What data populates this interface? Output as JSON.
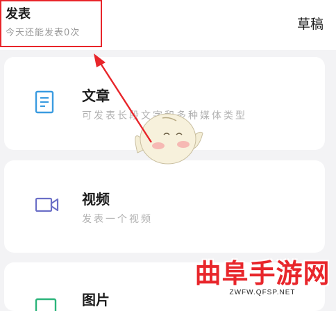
{
  "header": {
    "title": "发表",
    "subtitle": "今天还能发表0次",
    "draft_label": "草稿"
  },
  "options": [
    {
      "title": "文章",
      "subtitle": "可发表长段文字和多种媒体类型",
      "icon": "document-icon"
    },
    {
      "title": "视频",
      "subtitle": "发表一个视频",
      "icon": "video-camera-icon"
    },
    {
      "title": "图片",
      "subtitle": "",
      "icon": "image-icon"
    }
  ],
  "watermark": {
    "main": "曲阜手游网",
    "url": "ZWFW.QFSP.NET"
  },
  "colors": {
    "accent_red": "#e8252a",
    "icon_blue": "#3a9be0",
    "icon_purple": "#6b6fc7",
    "icon_green": "#2bb47a"
  }
}
